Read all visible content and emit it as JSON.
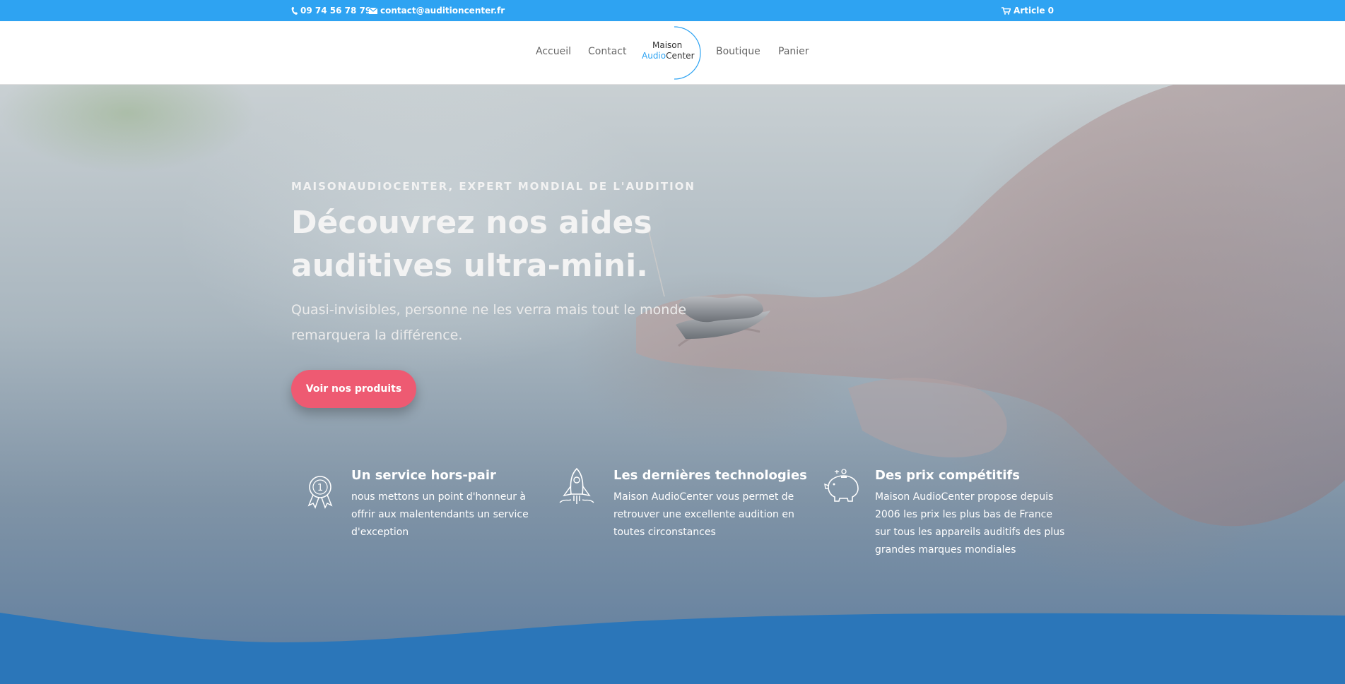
{
  "topbar": {
    "phone": "09 74 56 78 79",
    "email": "contact@auditioncenter.fr",
    "cart": "Article 0",
    "bg_color": "#2ea3f2"
  },
  "nav": {
    "items": [
      {
        "label": "Accueil"
      },
      {
        "label": "Contact"
      },
      {
        "label": "Boutique"
      },
      {
        "label": "Panier"
      }
    ],
    "logo": {
      "line1": "Maison",
      "line2a": "Audio",
      "line2b": "Center"
    }
  },
  "hero": {
    "eyebrow": "MAISONAUDIOCENTER, EXPERT MONDIAL DE L'AUDITION",
    "headline": "Découvrez nos aides auditives ultra-mini.",
    "subhead": "Quasi-invisibles, personne ne les verra mais tout le monde remarquera la différence.",
    "cta": "Voir nos produits",
    "cta_color": "#ee5a72"
  },
  "features": [
    {
      "icon": "award-medal-icon",
      "title": "Un service hors-pair",
      "text": "nous mettons un point d'honneur à offrir aux malentendants un service d'exception"
    },
    {
      "icon": "rocket-icon",
      "title": "Les dernières technologies",
      "text": "Maison AudioCenter vous permet de retrouver une excellente audition en toutes circonstances"
    },
    {
      "icon": "piggy-bank-icon",
      "title": "Des prix compétitifs",
      "text": "Maison AudioCenter propose depuis 2006 les prix les plus bas de France sur tous les appareils auditifs des plus grandes marques mondiales"
    }
  ],
  "colors": {
    "accent": "#2ea3f2",
    "wave": "#2b76b9"
  }
}
